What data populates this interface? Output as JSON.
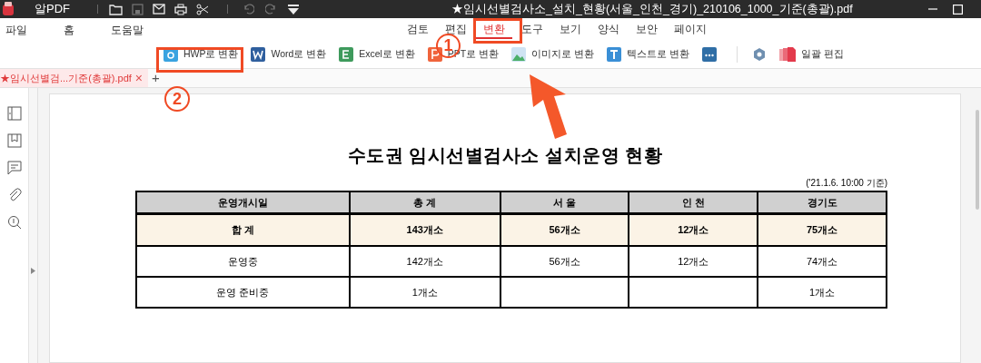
{
  "app": {
    "name": "알PDF",
    "title": "★임시선별검사소_설치_현황(서울_인천_경기)_210106_1000_기준(총괄).pdf"
  },
  "menu_left": [
    "파일",
    "홈",
    "도움말"
  ],
  "menu_tabs": [
    {
      "label": "검토",
      "selected": false
    },
    {
      "label": "편집",
      "selected": false
    },
    {
      "label": "변환",
      "selected": true
    },
    {
      "label": "도구",
      "selected": false
    },
    {
      "label": "보기",
      "selected": false
    },
    {
      "label": "양식",
      "selected": false
    },
    {
      "label": "보안",
      "selected": false
    },
    {
      "label": "페이지",
      "selected": false
    }
  ],
  "toolbar": [
    {
      "kind": "hwp",
      "label": "HWP로 변환"
    },
    {
      "kind": "word",
      "label": "Word로 변환"
    },
    {
      "kind": "excel",
      "label": "Excel로 변환"
    },
    {
      "kind": "ppt",
      "label": "PPT로 변환"
    },
    {
      "kind": "image",
      "label": "이미지로 변환"
    },
    {
      "kind": "text",
      "label": "텍스트로 변환"
    },
    {
      "kind": "more"
    },
    {
      "kind": "hex"
    },
    {
      "kind": "batch",
      "label": "일괄 편집"
    }
  ],
  "doc_tab": {
    "label": "★임시선별검...기준(총괄).pdf",
    "close": "×",
    "add": "+"
  },
  "document": {
    "title": "수도권 임시선별검사소 설치운영 현황",
    "note": "('21.1.6. 10:00 기준)",
    "table": {
      "columns": [
        "운영개시일",
        "총 계",
        "서 울",
        "인 천",
        "경기도"
      ],
      "rows": [
        {
          "kind": "total",
          "cells": [
            "합 계",
            "143개소",
            "56개소",
            "12개소",
            "75개소"
          ]
        },
        {
          "kind": "normal",
          "cells": [
            "운영중",
            "142개소",
            "56개소",
            "12개소",
            "74개소"
          ]
        },
        {
          "kind": "normal",
          "cells": [
            "운영 준비중",
            "1개소",
            "",
            "",
            "1개소"
          ]
        }
      ]
    }
  },
  "annotations": {
    "mark_1": "1",
    "mark_2": "2"
  }
}
